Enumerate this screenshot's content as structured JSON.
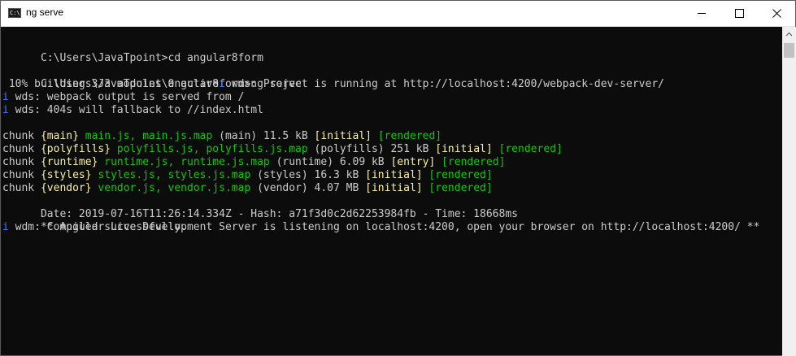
{
  "window": {
    "title": "ng serve",
    "icon": "console-icon",
    "icon_glyph": "C:\\"
  },
  "controls": {
    "minimize": "minimize-icon",
    "maximize": "maximize-icon",
    "close": "close-icon"
  },
  "colors": {
    "background": "#0c0c0c",
    "text": "#cccccc",
    "info_blue": "#3b78ff",
    "yellow": "#f9f1a5",
    "green": "#16c60c"
  },
  "console": {
    "line1": "C:\\Users\\JavaTpoint>cd angular8form",
    "line2": "C:\\Users\\JavaTpoint\\angular8form>ng serve",
    "line3_progress": " 10% building 3/3 modules 0 active",
    "line3_i": "i",
    "line3_msg": " ⁨wds⁩: Project is running at http://localhost:4200/webpack-dev-server/",
    "line4_i": "i",
    "line4_msg": " ⁨wds⁩: webpack output is served from /",
    "line5_i": "i",
    "line5_msg": " ⁨wds⁩: 404s will fallback to //index.html",
    "chunks": [
      {
        "prefix": "chunk ",
        "name": "{main}",
        "files": " main.js, main.js.map",
        "size": " (main) 11.5 kB ",
        "flag": "[initial]",
        "status": " [rendered]"
      },
      {
        "prefix": "chunk ",
        "name": "{polyfills}",
        "files": " polyfills.js, polyfills.js.map",
        "size": " (polyfills) 251 kB ",
        "flag": "[initial]",
        "status": " [rendered]"
      },
      {
        "prefix": "chunk ",
        "name": "{runtime}",
        "files": " runtime.js, runtime.js.map",
        "size": " (runtime) 6.09 kB ",
        "flag": "[entry]",
        "status": " [rendered]"
      },
      {
        "prefix": "chunk ",
        "name": "{styles}",
        "files": " styles.js, styles.js.map",
        "size": " (styles) 16.3 kB ",
        "flag": "[initial]",
        "status": " [rendered]"
      },
      {
        "prefix": "chunk ",
        "name": "{vendor}",
        "files": " vendor.js, vendor.js.map",
        "size": " (vendor) 4.07 MB ",
        "flag": "[initial]",
        "status": " [rendered]"
      }
    ],
    "date_line": "Date: 2019-07-16T11:26:14.334Z - Hash: a71f3d0c2d62253984fb - Time: 18668ms",
    "server_line": "** Angular Live Development Server is listening on localhost:4200, open your browser on http://localhost:4200/ **",
    "last_i": "i",
    "last_msg": " ⁨wdm⁩: Compiled successfully."
  }
}
